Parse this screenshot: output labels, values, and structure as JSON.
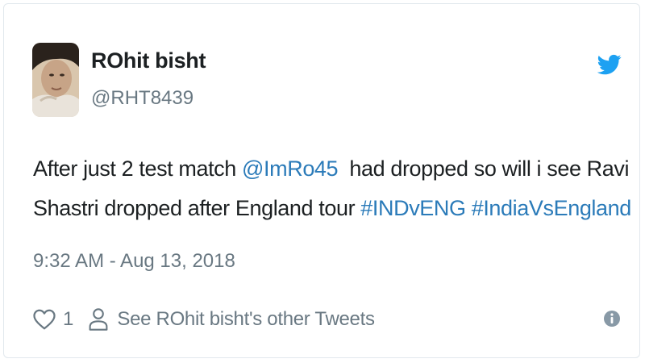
{
  "tweet": {
    "author": {
      "name": "ROhit bisht",
      "handle": "@RHT8439"
    },
    "text": {
      "line1": [
        {
          "text": "After just 2 test match ",
          "type": "plain"
        },
        {
          "text": "@ImRo45",
          "type": "mention"
        },
        {
          "text": "  had dropped so will i see Ravi",
          "type": "plain"
        }
      ],
      "line2": [
        {
          "text": "Shastri dropped after England tour ",
          "type": "plain"
        },
        {
          "text": "#INDvENG",
          "type": "hashtag"
        },
        {
          "text": " ",
          "type": "plain"
        },
        {
          "text": "#IndiaVsEngland",
          "type": "hashtag"
        }
      ]
    },
    "timestamp": "9:32 AM - Aug 13, 2018",
    "actions": {
      "likes": "1",
      "other_tweets_label": "See ROhit bisht's other Tweets"
    },
    "icons": {
      "logo": "twitter-bird-icon",
      "like": "heart-icon",
      "profile": "user-icon",
      "info": "info-icon"
    },
    "colors": {
      "link": "#2b7bb9",
      "brand": "#1da1f2",
      "secondary_text": "#697882",
      "primary_text": "#1c2022"
    }
  }
}
